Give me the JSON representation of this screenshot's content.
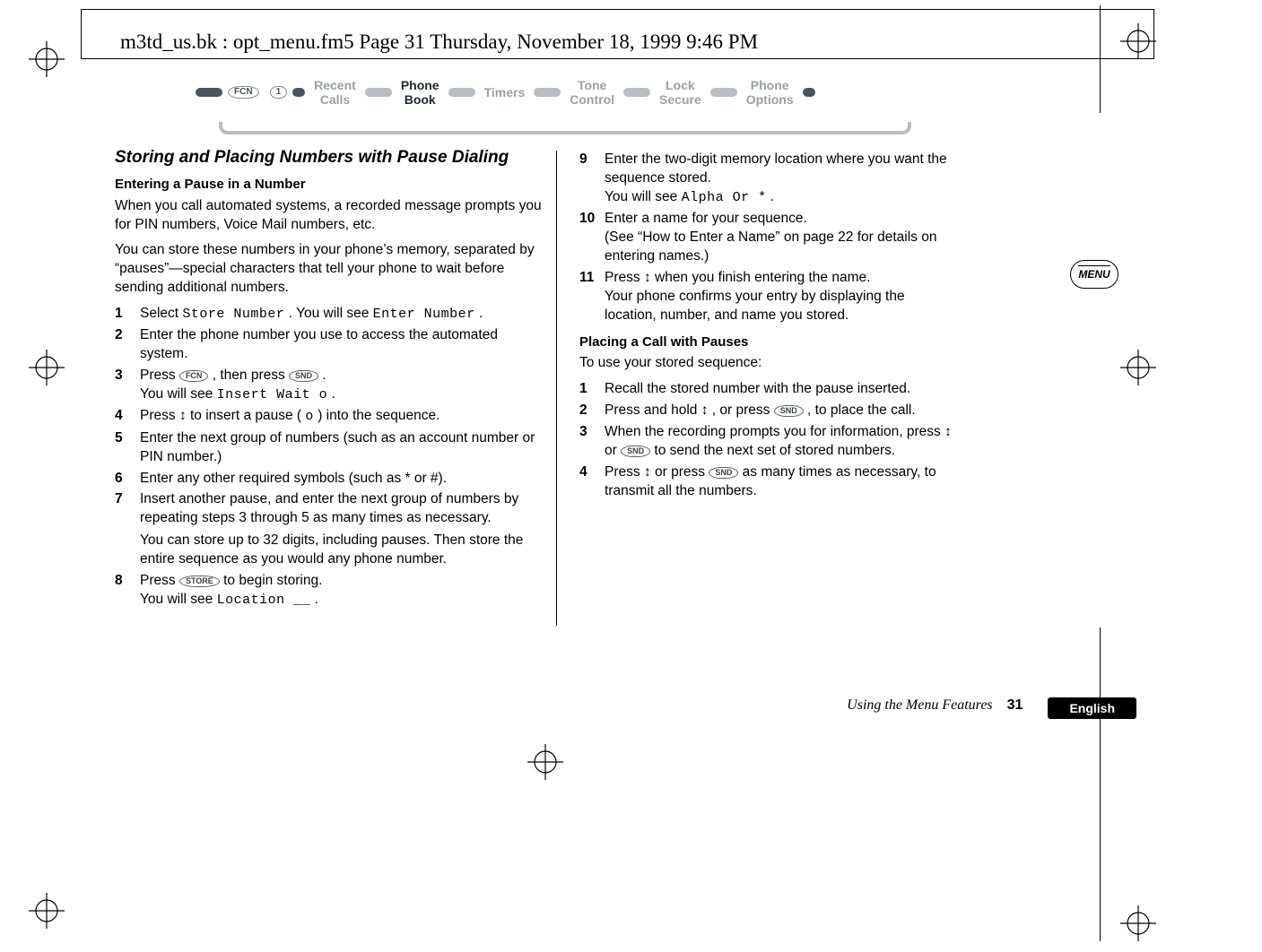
{
  "header": {
    "running_head": "m3td_us.bk : opt_menu.fm5  Page 31  Thursday, November 18, 1999  9:46 PM"
  },
  "nav": {
    "fcn_label": "FCN",
    "one_label": "1",
    "items": [
      {
        "l1": "Recent",
        "l2": "Calls",
        "active": false
      },
      {
        "l1": "Phone",
        "l2": "Book",
        "active": true
      },
      {
        "l1": "Timers",
        "l2": "",
        "active": false
      },
      {
        "l1": "Tone",
        "l2": "Control",
        "active": false
      },
      {
        "l1": "Lock",
        "l2": "Secure",
        "active": false
      },
      {
        "l1": "Phone",
        "l2": "Options",
        "active": false
      }
    ]
  },
  "left": {
    "section_title": "Storing and Placing Numbers with Pause Dialing",
    "sub1_title": "Entering a Pause in a Number",
    "p1": "When you call automated systems, a recorded message prompts you for PIN numbers, Voice Mail numbers, etc.",
    "p2": "You can store these numbers in your phone’s memory, separated by “pauses”—special characters that tell your phone to wait before sending additional numbers.",
    "steps": {
      "s1a": "Select ",
      "s1b": "Store Number",
      "s1c": ". You will see ",
      "s1d": "Enter Number",
      "s1e": ".",
      "s2": "Enter the phone number you use to access the automated system.",
      "s3a": "Press ",
      "s3b": ", then press ",
      "s3c": ".",
      "s3_note_a": "You will see ",
      "s3_note_b": "Insert Wait o",
      "s3_note_c": ".",
      "s4a": "Press ",
      "s4b": " to insert a pause (",
      "s4c": ") into the sequence.",
      "s4_glyph_arrow": "↕",
      "s4_pause_char": "o",
      "s5": "Enter the next group of numbers (such as an account number or PIN number.)",
      "s6": "Enter any other required symbols (such as * or #).",
      "s7": "Insert another pause, and enter the next group of numbers by repeating steps 3 through 5 as many times as necessary.",
      "s7_note": "You can store up to 32 digits, including pauses. Then store the entire sequence as you would any phone number.",
      "s8a": "Press ",
      "s8b": " to begin storing.",
      "s8_note_a": "You will see ",
      "s8_note_b": "Location __",
      "s8_note_c": "."
    },
    "oval_fcn": "FCN",
    "oval_snd": "SND",
    "oval_store": "STORE"
  },
  "right": {
    "s9": "Enter the two-digit memory location where you want the sequence stored.",
    "s9_note_a": "You will see ",
    "s9_note_b": "Alpha Or *",
    "s9_note_c": ".",
    "s10": "Enter a name for your sequence.",
    "s10_note": "(See “How to Enter a Name” on page 22 for details on entering names.)",
    "s11a": "Press ",
    "s11b": " when you finish entering the name.",
    "s11_note": "Your phone confirms your entry by displaying the location, number, and name you stored.",
    "s11_glyph_arrow": "↕",
    "sub2_title": "Placing a Call with Pauses",
    "p3": "To use your stored sequence:",
    "ps1": "Recall the stored number with the pause inserted.",
    "ps2a": "Press and hold ",
    "ps2b": ", or press ",
    "ps2c": ", to place the call.",
    "ps2_arrow": "↕",
    "ps3a": "When the recording prompts you for information, press ",
    "ps3b": " or ",
    "ps3c": " to send the next set of stored numbers.",
    "ps3_arrow": "↕",
    "ps4a": "Press ",
    "ps4b": " or press ",
    "ps4c": " as many times as necessary, to transmit all the numbers.",
    "ps4_arrow": "↕",
    "oval_snd": "SND"
  },
  "sidebar": {
    "menu_label": "MENU"
  },
  "footer": {
    "section": "Using the Menu Features",
    "page": "31",
    "lang": "English"
  }
}
